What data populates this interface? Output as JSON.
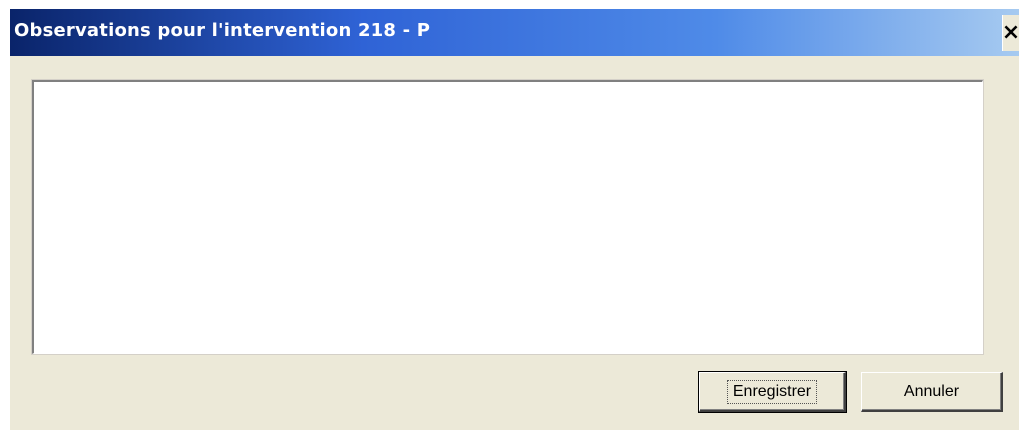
{
  "window": {
    "title": "Observations pour l'intervention 218 - P",
    "close_glyph": "×"
  },
  "observations": {
    "value": ""
  },
  "buttons": {
    "save_label": "Enregistrer",
    "cancel_label": "Annuler"
  },
  "colors": {
    "titlebar_start": "#0a246a",
    "titlebar_end": "#a6caf0",
    "face": "#ece9d8"
  }
}
